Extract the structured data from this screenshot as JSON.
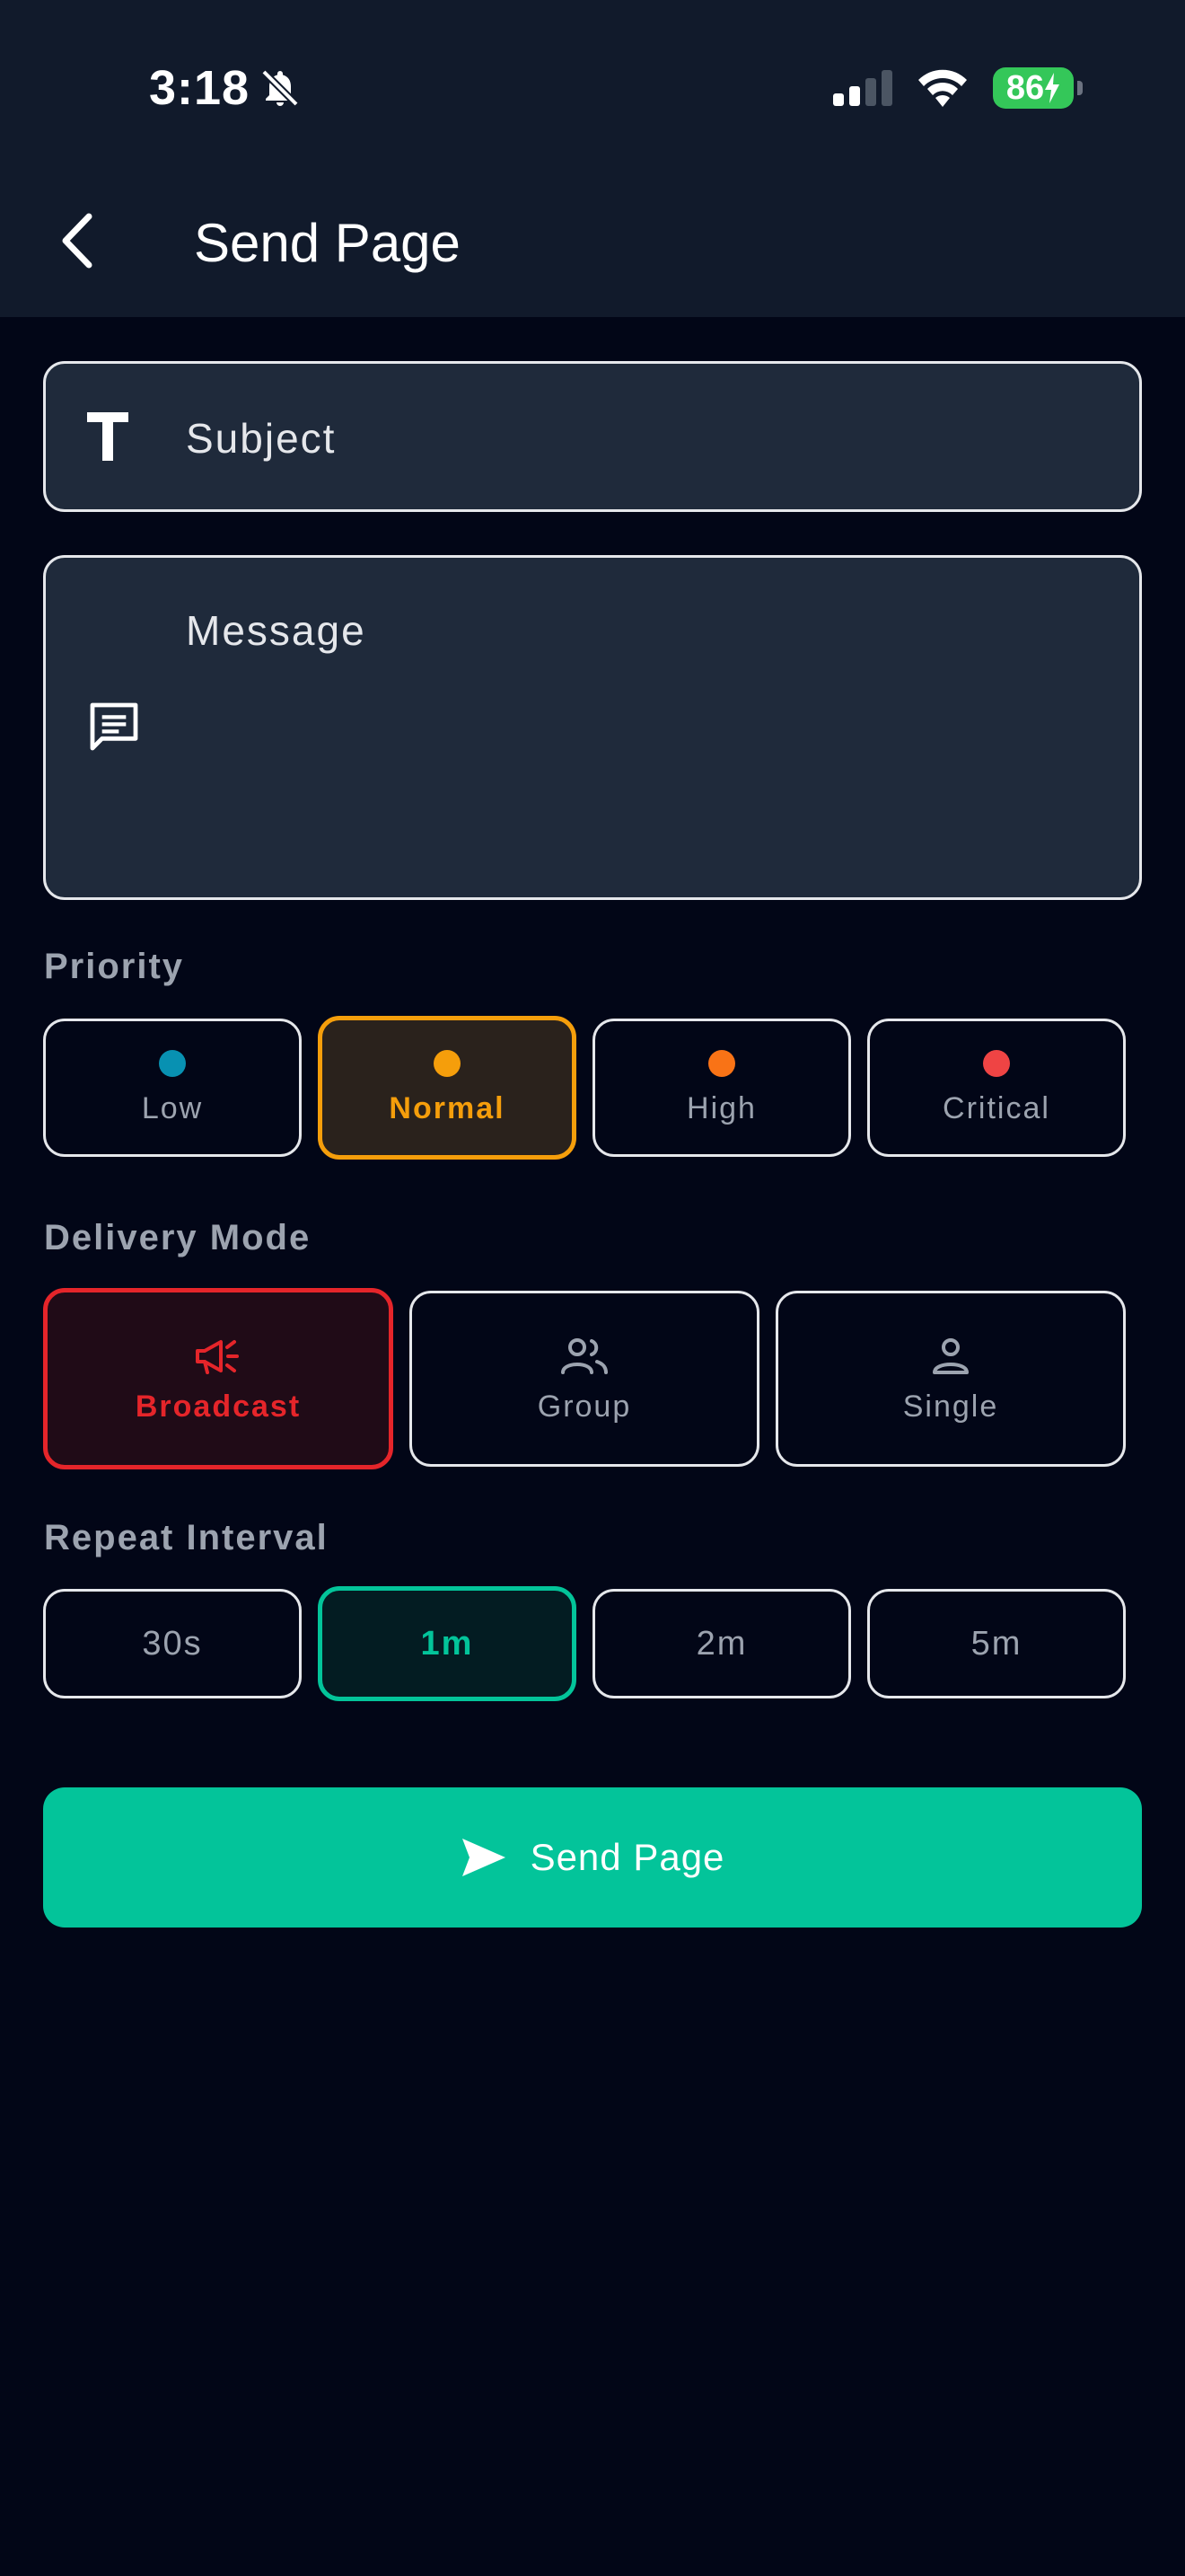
{
  "status_bar": {
    "time": "3:18",
    "battery": "86"
  },
  "header": {
    "title": "Send Page"
  },
  "form": {
    "subject_placeholder": "Subject",
    "message_placeholder": "Message"
  },
  "priority": {
    "label": "Priority",
    "options": [
      {
        "label": "Low",
        "color": "#0891b2"
      },
      {
        "label": "Normal",
        "color": "#f59e0b",
        "selected": true
      },
      {
        "label": "High",
        "color": "#f97316"
      },
      {
        "label": "Critical",
        "color": "#ef4444"
      }
    ]
  },
  "delivery_mode": {
    "label": "Delivery Mode",
    "options": [
      {
        "label": "Broadcast",
        "icon": "megaphone-icon",
        "selected": true
      },
      {
        "label": "Group",
        "icon": "people-icon"
      },
      {
        "label": "Single",
        "icon": "person-icon"
      }
    ]
  },
  "repeat_interval": {
    "label": "Repeat Interval",
    "options": [
      {
        "label": "30s"
      },
      {
        "label": "1m",
        "selected": true
      },
      {
        "label": "2m"
      },
      {
        "label": "5m"
      }
    ]
  },
  "send_button": {
    "label": "Send Page"
  },
  "colors": {
    "accent": "#03c49a",
    "normal_priority": "#f59e0b",
    "broadcast": "#e5252a",
    "background": "#020617"
  }
}
